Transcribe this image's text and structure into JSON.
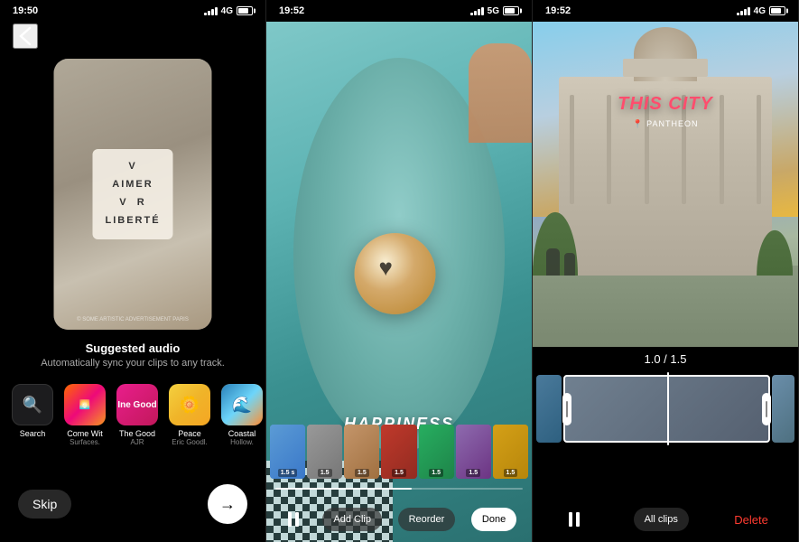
{
  "panel1": {
    "status": {
      "time": "19:50",
      "network": "4G",
      "battery": 85
    },
    "preview_text": "AIMER\nVIVRE\nLIBERTÉ",
    "watermark": "© SOME ARTISTIC ADVERTISEMENT PARIS",
    "suggested_title": "Suggested audio",
    "suggested_sub": "Automatically sync your clips to any track.",
    "audio_items": [
      {
        "label": "Search",
        "sub": "",
        "type": "search"
      },
      {
        "label": "Come Wit",
        "sub": "Surfaces.",
        "type": "orange"
      },
      {
        "label": "The Good",
        "sub": "AJR",
        "type": "pink"
      },
      {
        "label": "Peace",
        "sub": "Eric Goodl.",
        "type": "blue"
      },
      {
        "label": "Coastal",
        "sub": "Hollow.",
        "type": "yellow"
      }
    ],
    "skip_label": "Skip",
    "next_label": "→"
  },
  "panel2": {
    "status": {
      "time": "19:52",
      "network": "5G",
      "battery": 80
    },
    "happiness_text": "HAPPINESS",
    "film_clips": [
      {
        "duration": "1.5 s",
        "color": "ft1"
      },
      {
        "duration": "1.5",
        "color": "ft2"
      },
      {
        "duration": "1.5",
        "color": "ft3"
      },
      {
        "duration": "1.5",
        "color": "ft4"
      },
      {
        "duration": "1.5",
        "color": "ft5"
      },
      {
        "duration": "1.5",
        "color": "ft6"
      },
      {
        "duration": "1.5",
        "color": "ft7"
      }
    ],
    "controls": {
      "pause": "⏸",
      "add_clip": "Add Clip",
      "reorder": "Reorder",
      "done": "Done"
    }
  },
  "panel3": {
    "status": {
      "time": "19:52",
      "network": "4G",
      "battery": 85
    },
    "this_city": "THIS CITY",
    "pantheon_label": "📍 PANTHEON",
    "counter": "1.0  /  1.5",
    "controls": {
      "pause": "⏸",
      "all_clips": "All clips",
      "delete": "Delete"
    }
  }
}
